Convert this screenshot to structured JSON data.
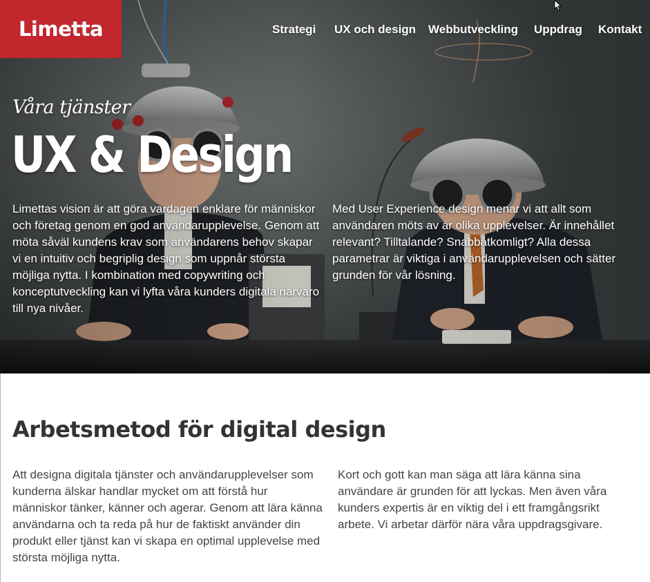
{
  "brand": {
    "logo_text": "Limetta",
    "color": "#c1272d"
  },
  "nav": {
    "items": [
      {
        "label": "Strategi"
      },
      {
        "label": "UX och design"
      },
      {
        "label": "Webbutveckling"
      },
      {
        "label": "Uppdrag"
      },
      {
        "label": "Kontakt"
      }
    ]
  },
  "hero": {
    "eyebrow": "Våra tjänster",
    "title": "UX & Design",
    "left_text": "Limettas vision är att göra vardagen enklare för människor och företag genom en god användarupplevelse. Genom att möta såväl kundens krav som användarens behov skapar vi en intuitiv och begriplig design som uppnår största möjliga nytta. I kombination med copywriting och konceptutveckling kan vi lyfta våra kunders digitala närvaro till nya nivåer.",
    "right_text": "Med User Experience design menar vi att allt som användaren möts av är olika upplevelser. Är innehållet relevant? Tilltalande? Snabbåtkomligt? Alla dessa parametrar är viktiga i användarupplevelsen och sätter grunden för vår lösning."
  },
  "section": {
    "title": "Arbetsmetod för digital design",
    "left_text": "Att designa digitala tjänster och användarupplevelser som kunderna älskar handlar mycket om att förstå hur människor tänker, känner och agerar. Genom att lära känna användarna och ta reda på hur de faktiskt använder din produkt eller tjänst kan vi skapa en optimal upplevelse med största möjliga nytta.",
    "right_text": "Kort och gott kan man säga att lära känna sina användare är grunden för att lyckas. Men även våra kunders expertis är en viktig del i ett framgångsrikt arbete. Vi arbetar därför nära våra uppdragsgivare."
  }
}
